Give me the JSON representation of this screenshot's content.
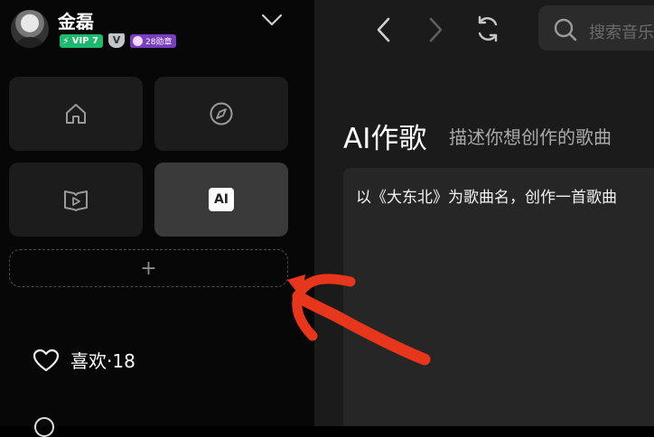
{
  "user": {
    "name": "金磊",
    "vip_label": "VIP 7",
    "shield_label": "V",
    "medal_label": "28勋章"
  },
  "sidebar": {
    "tiles": [
      {
        "name": "home",
        "icon": "home-icon"
      },
      {
        "name": "discover",
        "icon": "compass-icon"
      },
      {
        "name": "video",
        "icon": "video-book-icon"
      },
      {
        "name": "ai",
        "icon": "ai-icon",
        "label": "AI",
        "active": true
      }
    ],
    "add_symbol": "+",
    "likes_label": "喜欢·18"
  },
  "toolbar": {
    "search_placeholder": "搜索音乐"
  },
  "main": {
    "title": "AI作歌",
    "subtitle": "描述你想创作的歌曲",
    "prompt_text": "以《大东北》为歌曲名，创作一首歌曲"
  },
  "colors": {
    "accent_green": "#1db96c",
    "medal_purple": "#7a3fc0",
    "annotation_arrow": "#e8361c"
  }
}
